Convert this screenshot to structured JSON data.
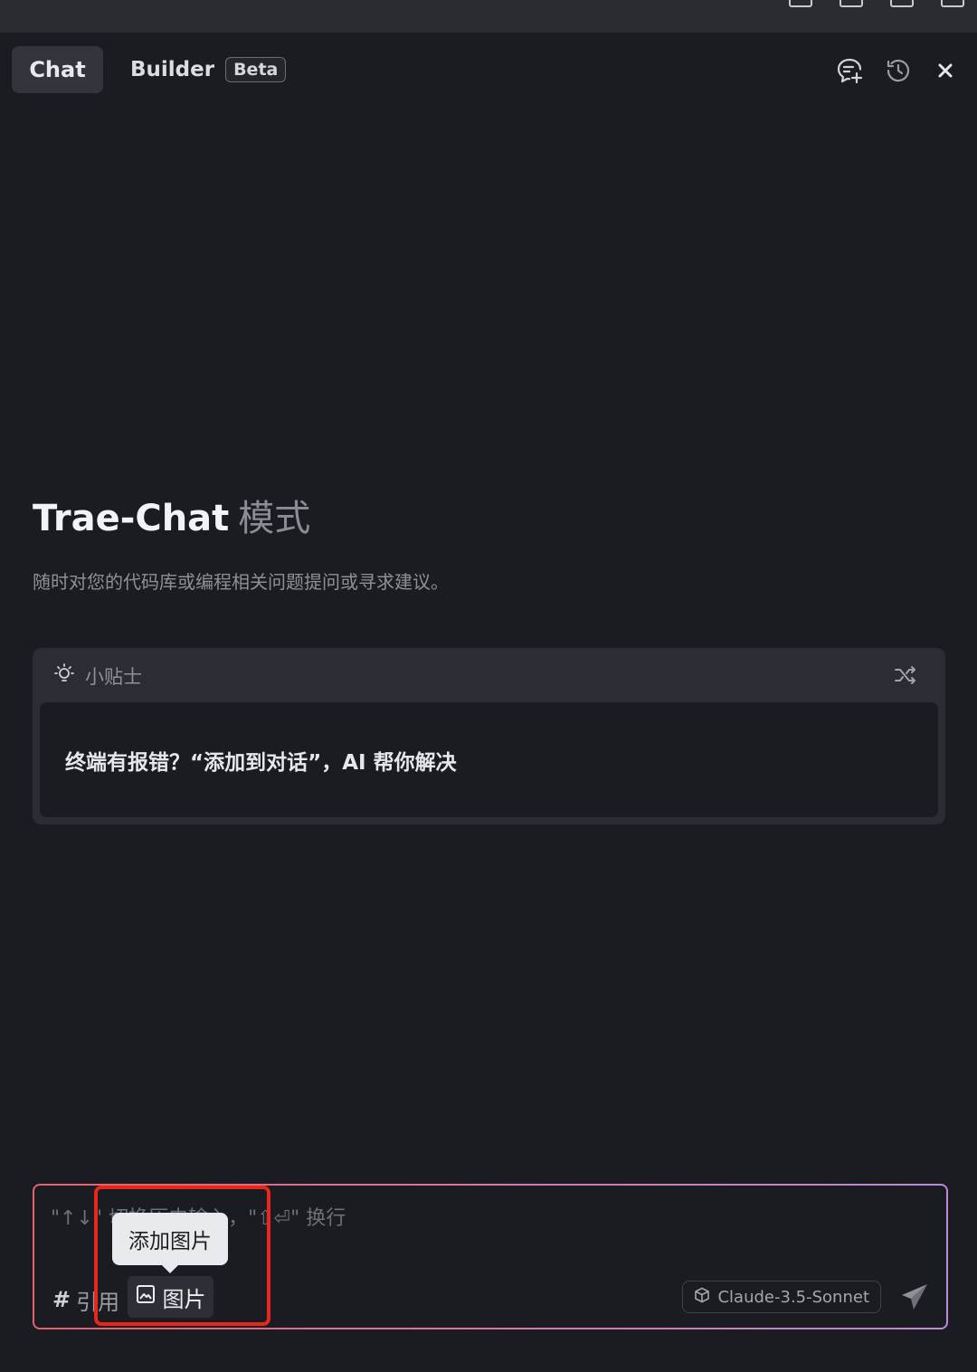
{
  "header": {
    "tabs": [
      {
        "label": "Chat",
        "active": true
      },
      {
        "label": "Builder",
        "badge": "Beta",
        "active": false
      }
    ],
    "icons": [
      "new-chat-icon",
      "history-icon",
      "close-icon"
    ]
  },
  "hero": {
    "title": "Trae-Chat",
    "title_mode": "模式",
    "subtitle": "随时对您的代码库或编程相关问题提问或寻求建议。"
  },
  "tips": {
    "title": "小贴士",
    "text": "终端有报错？“添加到对话”，AI 帮你解决"
  },
  "input": {
    "placeholder": "\"↑↓\" 切换历史输入，\"⇧⏎\" 换行",
    "reference_hash": "#",
    "reference_label": "引用",
    "image_label": "图片",
    "tooltip": "添加图片",
    "model": "Claude-3.5-Sonnet"
  },
  "colors": {
    "background": "#1b1c21",
    "highlight": "#e8261c",
    "border_gradient_start": "#e0636b",
    "border_gradient_end": "#b98bd8"
  }
}
